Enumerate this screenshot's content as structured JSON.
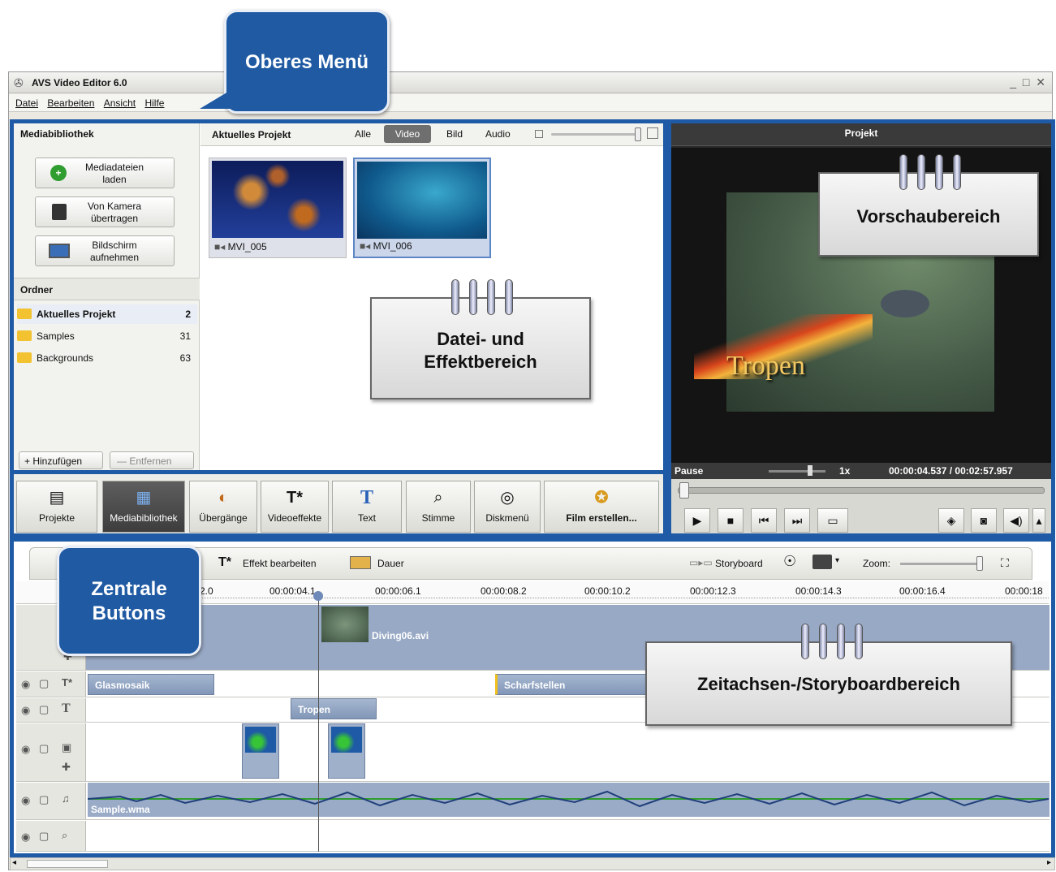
{
  "window": {
    "title": "AVS Video Editor 6.0",
    "controls": "_ □ ✕"
  },
  "menu": [
    "Datei",
    "Bearbeiten",
    "Ansicht",
    "Hilfe"
  ],
  "library": {
    "title": "Mediabibliothek",
    "buttons": [
      {
        "label": "Mediadateien laden",
        "icon": "plus-icon"
      },
      {
        "label": "Von Kamera übertragen",
        "icon": "camera-icon"
      },
      {
        "label": "Bildschirm aufnehmen",
        "icon": "screen-capture-icon"
      }
    ],
    "folders_title": "Ordner",
    "folders": [
      {
        "name": "Aktuelles Projekt",
        "count": "2"
      },
      {
        "name": "Samples",
        "count": "31"
      },
      {
        "name": "Backgrounds",
        "count": "63"
      }
    ],
    "add_label": "+ Hinzufügen",
    "remove_label": "— Entfernen"
  },
  "project_panel": {
    "title": "Aktuelles Projekt",
    "filters": [
      "Alle",
      "Video",
      "Bild",
      "Audio"
    ],
    "active_filter": "Video",
    "items": [
      {
        "name": "MVI_005",
        "colors": [
          "#1a2b6e",
          "#c86a1e"
        ]
      },
      {
        "name": "MVI_006",
        "colors": [
          "#0a4a7a",
          "#2a8fb5"
        ]
      }
    ]
  },
  "preview": {
    "title": "Projekt",
    "overlay_text": "Tropen",
    "status": "Pause",
    "speed": "1x",
    "time": "00:00:04.537 / 00:02:57.957"
  },
  "central_buttons": [
    {
      "label": "Projekte",
      "icon": "projects-icon",
      "active": false
    },
    {
      "label": "Mediabibliothek",
      "icon": "library-icon",
      "active": true
    },
    {
      "label": "Übergänge",
      "icon": "transitions-icon",
      "active": false
    },
    {
      "label": "Videoeffekte",
      "icon": "effects-icon",
      "active": false
    },
    {
      "label": "Text",
      "icon": "text-icon",
      "active": false
    },
    {
      "label": "Stimme",
      "icon": "microphone-icon",
      "active": false
    },
    {
      "label": "Diskmenü",
      "icon": "disc-menu-icon",
      "active": false
    },
    {
      "label": "Film erstellen...",
      "icon": "create-movie-icon",
      "active": false
    }
  ],
  "timeline": {
    "toolbar": {
      "edit_effect": "Effekt bearbeiten",
      "duration": "Dauer",
      "storyboard": "Storyboard",
      "zoom": "Zoom:"
    },
    "ruler": [
      "2.0",
      "00:00:04.1",
      "00:00:06.1",
      "00:00:08.2",
      "00:00:10.2",
      "00:00:12.3",
      "00:00:14.3",
      "00:00:16.4",
      "00:00:18"
    ],
    "video_clip": "Diving06.avi",
    "effect_clips": [
      "Glasmosaik",
      "Scharfstellen"
    ],
    "text_clip": "Tropen",
    "audio_clip": "Sample.wma"
  },
  "callouts": {
    "top_menu": "Oberes Menü",
    "file_effect_1": "Datei- und",
    "file_effect_2": "Effektbereich",
    "preview_area": "Vorschaubereich",
    "central_1": "Zentrale",
    "central_2": "Buttons",
    "timeline_area": "Zeitachsen-/Storyboardbereich"
  },
  "colors": {
    "accent": "#1e5aa6",
    "callout_blue": "#1f5aa3",
    "clip": "#8fa2c1"
  }
}
